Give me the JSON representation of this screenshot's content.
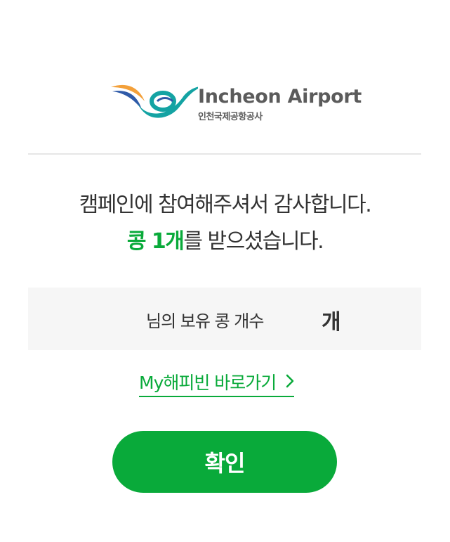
{
  "logo": {
    "name_en": "Incheon Airport",
    "name_ko": "인천국제공항공사"
  },
  "message": {
    "line1": "캠페인에 참여해주셔서 감사합니다.",
    "line2_highlight": "콩 1개",
    "line2_rest": "를 받으셨습니다."
  },
  "bean_count": {
    "label": "님의 보유 콩 개수",
    "unit": "개"
  },
  "happybean_link": {
    "label": "My해피빈 바로가기"
  },
  "confirm_button": {
    "label": "확인"
  },
  "colors": {
    "brand_green": "#09aa3a",
    "logo_teal": "#14a3a3",
    "logo_orange": "#f3a03a",
    "logo_blue": "#2f5aa8"
  }
}
